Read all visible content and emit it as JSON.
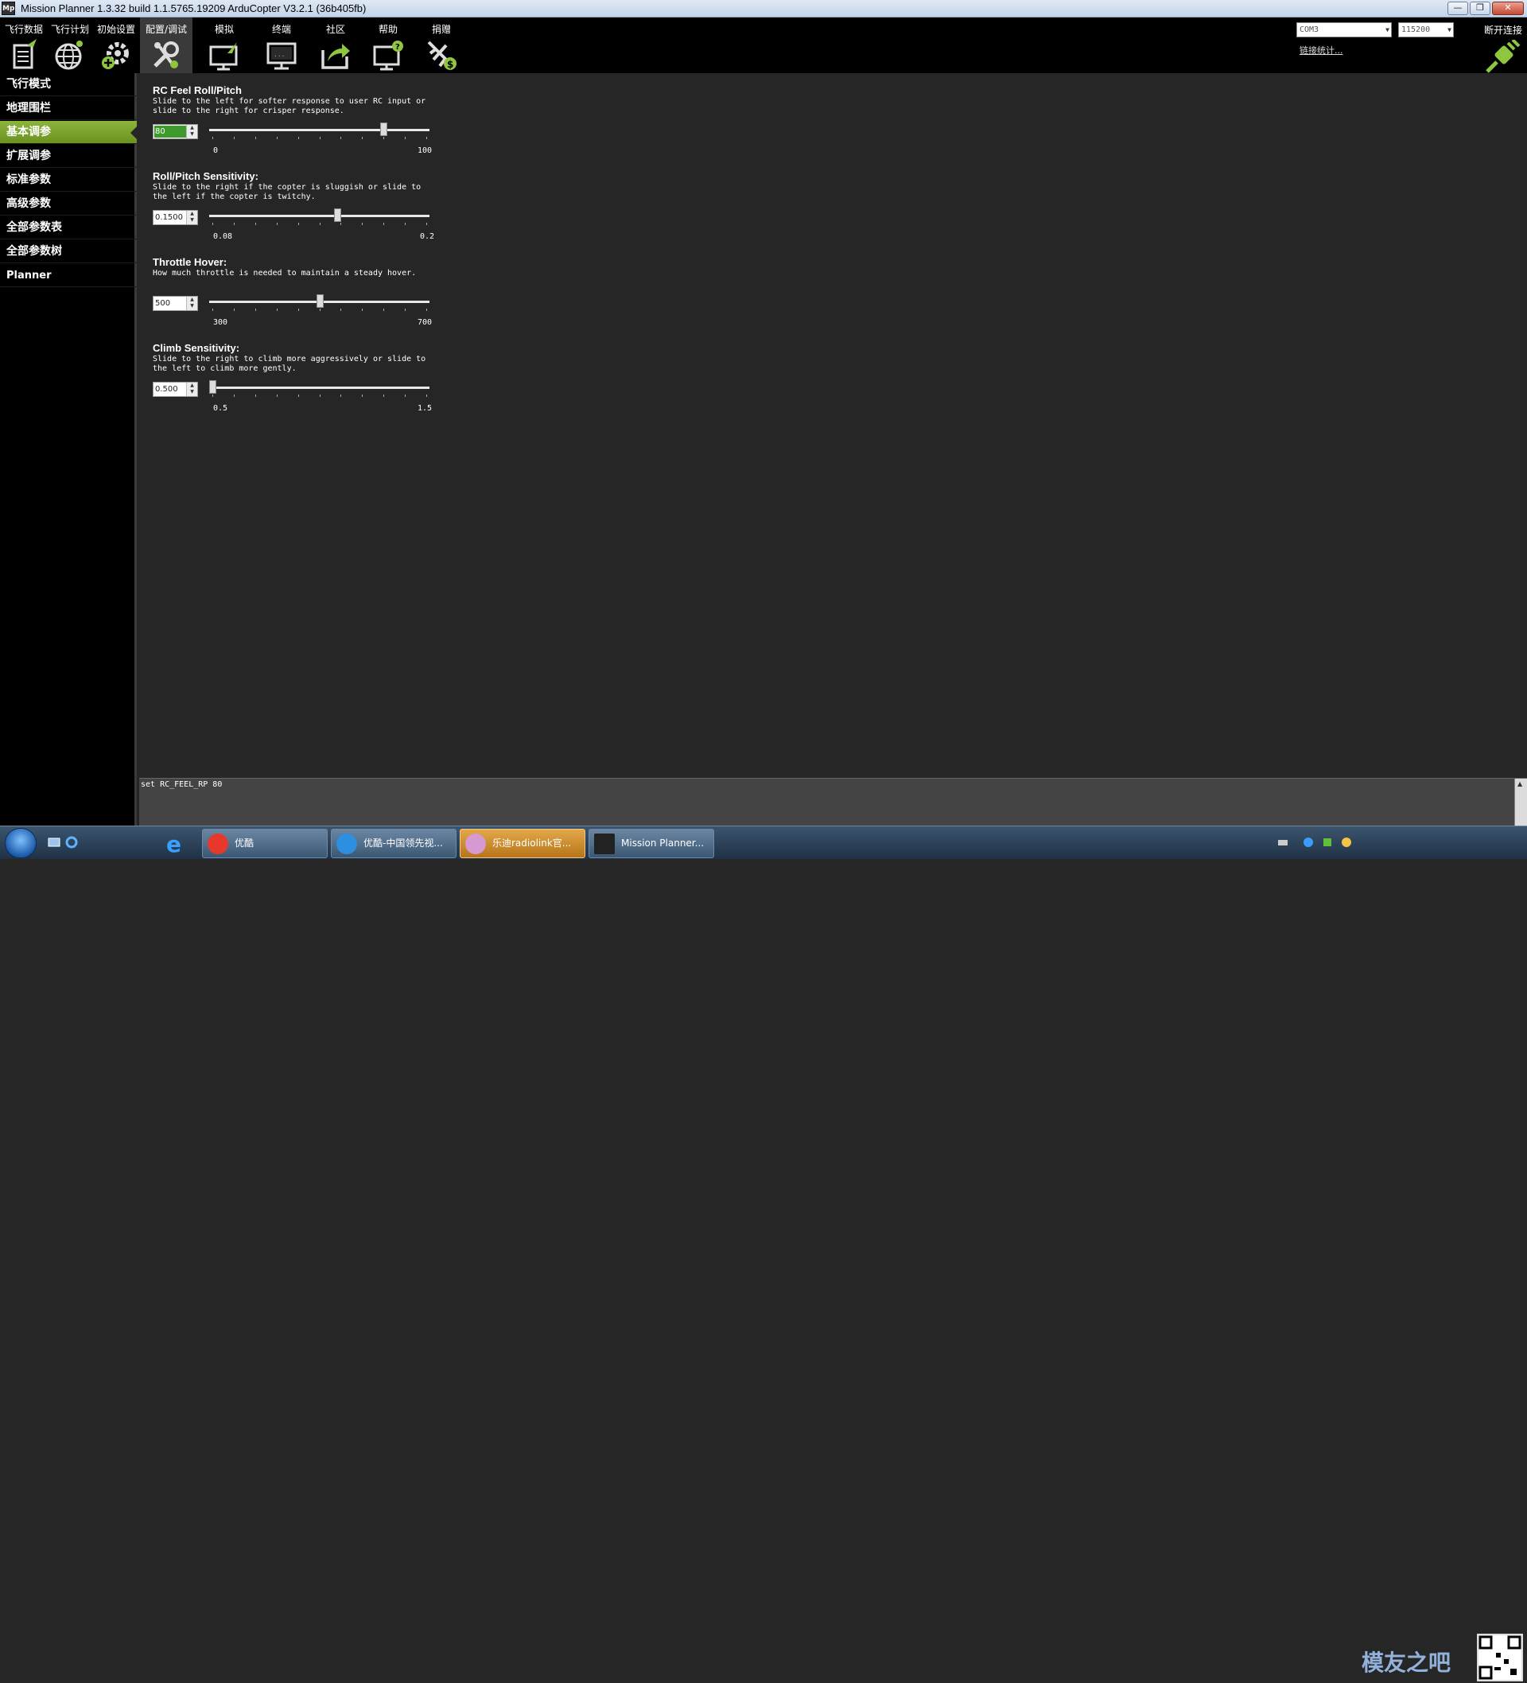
{
  "window": {
    "title": "Mission Planner 1.3.32 build 1.1.5765.19209 ArduCopter V3.2.1 (36b405fb)",
    "app_icon_text": "Mp",
    "minimize": "—",
    "maximize": "❐",
    "close": "✕"
  },
  "menu": {
    "items": [
      {
        "label": "飞行数据",
        "icon": "flight-data-icon"
      },
      {
        "label": "飞行计划",
        "icon": "flight-plan-globe-icon"
      },
      {
        "label": "初始设置",
        "icon": "initial-setup-gear-icon"
      },
      {
        "label": "配置/调试",
        "icon": "config-tuning-wrench-icon",
        "active": true
      },
      {
        "label": "模拟",
        "icon": "simulation-monitor-icon"
      },
      {
        "label": "终端",
        "icon": "terminal-monitor-icon"
      },
      {
        "label": "社区",
        "icon": "community-share-icon"
      },
      {
        "label": "帮助",
        "icon": "help-monitor-icon"
      },
      {
        "label": "捐赠",
        "icon": "donate-plane-icon"
      }
    ],
    "port_value": "COM3",
    "baud_value": "115200",
    "link_stats": "链接统计...",
    "connect_label": "断开连接"
  },
  "sidebar": {
    "items": [
      {
        "label": "飞行模式"
      },
      {
        "label": "地理围栏"
      },
      {
        "label": "基本调参",
        "active": true
      },
      {
        "label": "扩展调参"
      },
      {
        "label": "标准参数"
      },
      {
        "label": "高级参数"
      },
      {
        "label": "全部参数表"
      },
      {
        "label": "全部参数树"
      },
      {
        "label": "Planner"
      }
    ]
  },
  "params": [
    {
      "title": "RC Feel Roll/Pitch",
      "desc": "Slide to the left for softer response to user RC input or\nslide to the right for crisper response.",
      "value": "80",
      "min": "0",
      "max": "100",
      "level": 0.8
    },
    {
      "title": "Roll/Pitch Sensitivity:",
      "desc": "Slide to the right if the copter is sluggish or slide to\nthe left if the copter is twitchy.",
      "value": "0.1500",
      "min": "0.08",
      "max": "0.2",
      "level": 0.583
    },
    {
      "title": "Throttle Hover:",
      "desc": " How much throttle is needed to maintain a steady hover.",
      "value": "500",
      "min": "300",
      "max": "700",
      "level": 0.5
    },
    {
      "title": "Climb Sensitivity:",
      "desc": "Slide to the right to climb more aggressively or slide to\nthe left to climb more gently.",
      "value": "0.500",
      "min": "0.5",
      "max": "1.5",
      "level": 0.0
    }
  ],
  "console": {
    "text": "set RC_FEEL_RP 80"
  },
  "taskbar": {
    "buttons": [
      {
        "label": "优酷"
      },
      {
        "label": "优酷-中国领先视..."
      },
      {
        "label": "乐迪radiolink官..."
      },
      {
        "label": "Mission Planner..."
      }
    ],
    "watermark": "模友之吧"
  },
  "colors": {
    "accent_green": "#7aa82b",
    "value_highlight": "#3e9a2c",
    "background": "#262626"
  }
}
